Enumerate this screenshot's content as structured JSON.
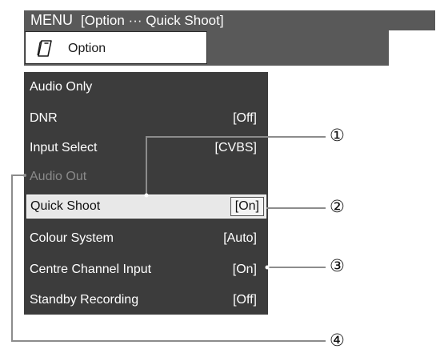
{
  "header": {
    "menu_label": "MENU",
    "breadcrumb": "[Option ··· Quick Shoot]"
  },
  "tab": {
    "label": "Option",
    "icon": "option-card-icon"
  },
  "menu": {
    "items": [
      {
        "label": "Audio Only",
        "value": "",
        "state": "normal"
      },
      {
        "label": "DNR",
        "value": "[Off]",
        "state": "normal"
      },
      {
        "label": "Input Select",
        "value": "[CVBS]",
        "state": "normal"
      },
      {
        "label": "Audio Out",
        "value": "",
        "state": "disabled"
      },
      {
        "label": "Quick Shoot",
        "value": "[On]",
        "state": "selected"
      },
      {
        "label": "Colour System",
        "value": "[Auto]",
        "state": "normal"
      },
      {
        "label": "Centre Channel Input",
        "value": "[On]",
        "state": "normal"
      },
      {
        "label": "Standby Recording",
        "value": "[Off]",
        "state": "normal"
      }
    ]
  },
  "callouts": [
    "①",
    "②",
    "③",
    "④"
  ],
  "colors": {
    "title_bar": "#595959",
    "panel": "#3c3c3c",
    "selected_row": "#e8e8e8",
    "disabled_text": "#8a8a8a"
  }
}
